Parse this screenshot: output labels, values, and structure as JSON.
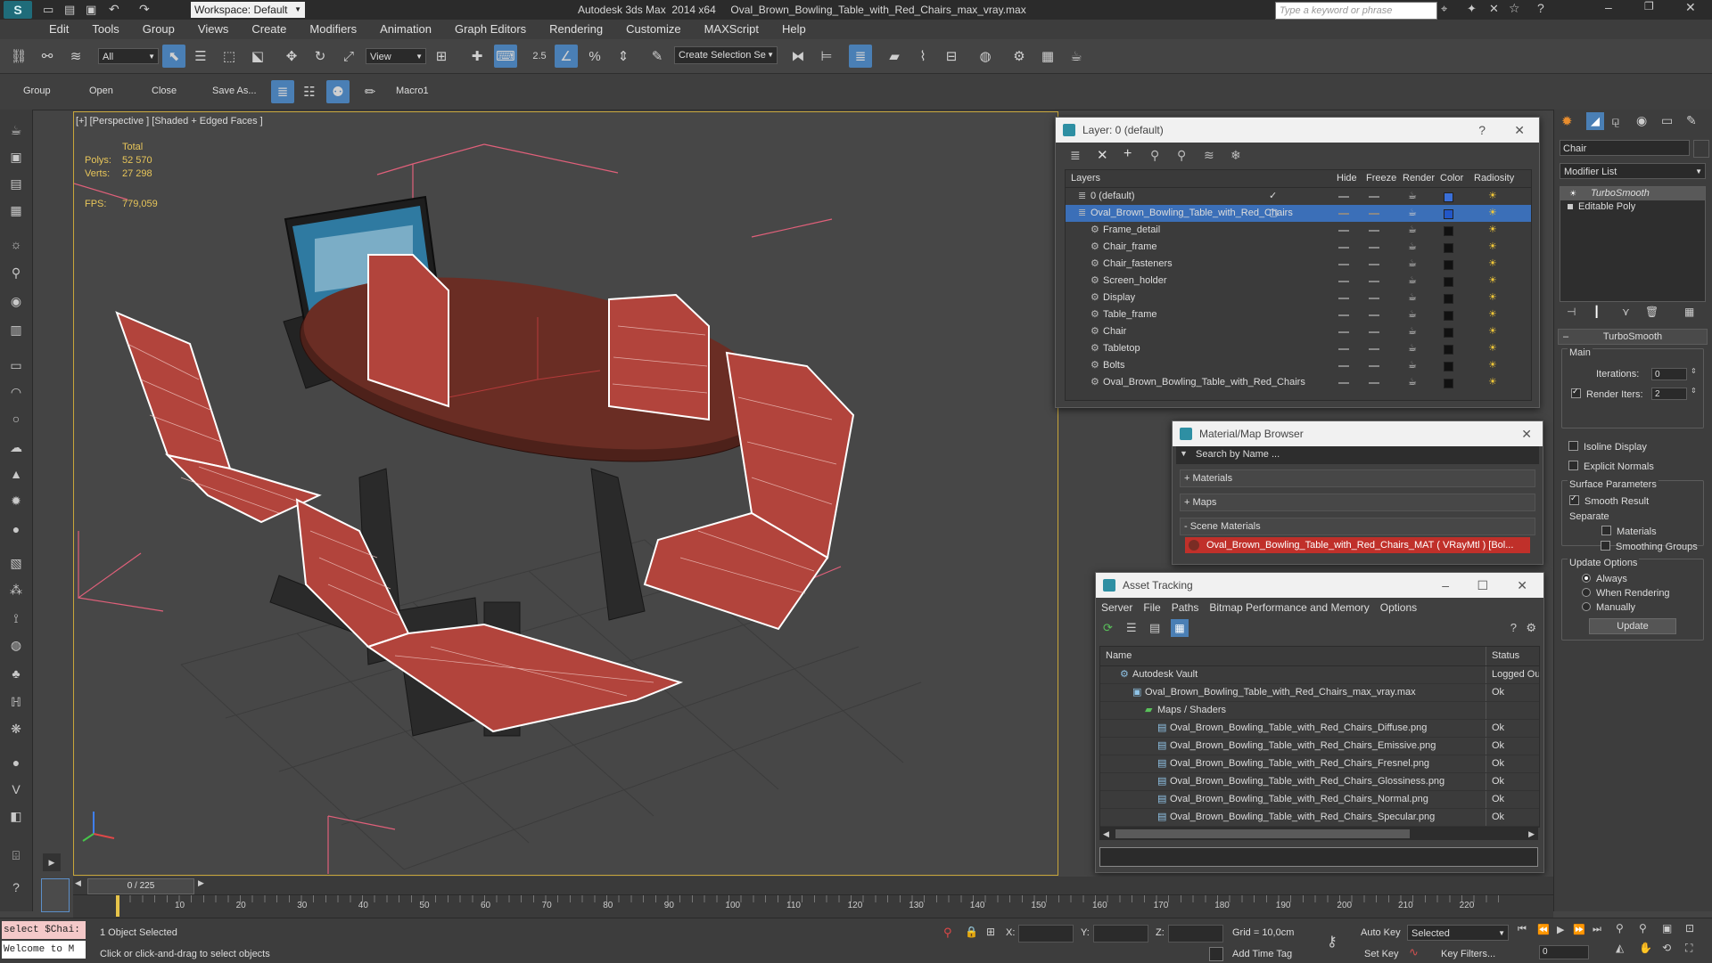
{
  "app": {
    "title": "Autodesk 3ds Max  2014 x64     Oval_Brown_Bowling_Table_with_Red_Chairs_max_vray.max",
    "workspace": "Workspace: Default",
    "search_placeholder": "Type a keyword or phrase"
  },
  "menu": [
    "Edit",
    "Tools",
    "Group",
    "Views",
    "Create",
    "Modifiers",
    "Animation",
    "Graph Editors",
    "Rendering",
    "Customize",
    "MAXScript",
    "Help"
  ],
  "toolbar": {
    "filter_dd": "All",
    "view_dd": "View",
    "selset_dd": "Create Selection Se",
    "snap_label": "2.5"
  },
  "ribbon": {
    "items": [
      "Group",
      "Open",
      "Close",
      "Save As...",
      "Macro1"
    ]
  },
  "viewport": {
    "label": "[+] [Perspective ] [Shaded + Edged Faces ]",
    "stats": {
      "total_label": "Total",
      "polys_label": "Polys:",
      "polys_value": "52 570",
      "verts_label": "Verts:",
      "verts_value": "27 298",
      "fps_label": "FPS:",
      "fps_value": "779,059"
    }
  },
  "layer_window": {
    "title": "Layer: 0 (default)",
    "columns": [
      "Layers",
      "Hide",
      "Freeze",
      "Render",
      "Color",
      "Radiosity"
    ],
    "rows": [
      {
        "name": "0 (default)",
        "indent": 0,
        "selected": false,
        "color": "#3a6fd8",
        "check": "✓"
      },
      {
        "name": "Oval_Brown_Bowling_Table_with_Red_Chairs",
        "indent": 0,
        "selected": true,
        "color": "#2257c8",
        "check": "▢"
      },
      {
        "name": "Frame_detail",
        "indent": 1,
        "selected": false,
        "color": "#111111",
        "check": ""
      },
      {
        "name": "Chair_frame",
        "indent": 1,
        "selected": false,
        "color": "#111111",
        "check": ""
      },
      {
        "name": "Chair_fasteners",
        "indent": 1,
        "selected": false,
        "color": "#111111",
        "check": ""
      },
      {
        "name": "Screen_holder",
        "indent": 1,
        "selected": false,
        "color": "#111111",
        "check": ""
      },
      {
        "name": "Display",
        "indent": 1,
        "selected": false,
        "color": "#111111",
        "check": ""
      },
      {
        "name": "Table_frame",
        "indent": 1,
        "selected": false,
        "color": "#111111",
        "check": ""
      },
      {
        "name": "Chair",
        "indent": 1,
        "selected": false,
        "color": "#111111",
        "check": ""
      },
      {
        "name": "Tabletop",
        "indent": 1,
        "selected": false,
        "color": "#111111",
        "check": ""
      },
      {
        "name": "Bolts",
        "indent": 1,
        "selected": false,
        "color": "#111111",
        "check": ""
      },
      {
        "name": "Oval_Brown_Bowling_Table_with_Red_Chairs",
        "indent": 1,
        "selected": false,
        "color": "#111111",
        "check": ""
      }
    ]
  },
  "material_browser": {
    "title": "Material/Map Browser",
    "search_placeholder": "Search by Name ...",
    "sections": [
      "+ Materials",
      "+ Maps",
      "- Scene Materials"
    ],
    "scene_material": "Oval_Brown_Bowling_Table_with_Red_Chairs_MAT ( VRayMtl ) [Bol..."
  },
  "asset_tracking": {
    "title": "Asset Tracking",
    "menu": [
      "Server",
      "File",
      "Paths",
      "Bitmap Performance and Memory",
      "Options"
    ],
    "columns": [
      "Name",
      "Status"
    ],
    "rows": [
      {
        "name": "Autodesk Vault",
        "indent": 0,
        "status": "Logged Ou"
      },
      {
        "name": "Oval_Brown_Bowling_Table_with_Red_Chairs_max_vray.max",
        "indent": 1,
        "status": "Ok"
      },
      {
        "name": "Maps / Shaders",
        "indent": 2,
        "status": ""
      },
      {
        "name": "Oval_Brown_Bowling_Table_with_Red_Chairs_Diffuse.png",
        "indent": 3,
        "status": "Ok"
      },
      {
        "name": "Oval_Brown_Bowling_Table_with_Red_Chairs_Emissive.png",
        "indent": 3,
        "status": "Ok"
      },
      {
        "name": "Oval_Brown_Bowling_Table_with_Red_Chairs_Fresnel.png",
        "indent": 3,
        "status": "Ok"
      },
      {
        "name": "Oval_Brown_Bowling_Table_with_Red_Chairs_Glossiness.png",
        "indent": 3,
        "status": "Ok"
      },
      {
        "name": "Oval_Brown_Bowling_Table_with_Red_Chairs_Normal.png",
        "indent": 3,
        "status": "Ok"
      },
      {
        "name": "Oval_Brown_Bowling_Table_with_Red_Chairs_Specular.png",
        "indent": 3,
        "status": "Ok"
      }
    ]
  },
  "command_panel": {
    "object_name": "Chair",
    "modifier_list": "Modifier List",
    "stack": [
      "TurboSmooth",
      "Editable Poly"
    ],
    "rollout_title": "TurboSmooth",
    "main_label": "Main",
    "iterations_label": "Iterations:",
    "iterations_value": "0",
    "render_iters_label": "Render Iters:",
    "render_iters_value": "2",
    "isoline_label": "Isoline Display",
    "explicit_label": "Explicit Normals",
    "surface_label": "Surface Parameters",
    "smooth_label": "Smooth Result",
    "separate_label": "Separate",
    "materials_label": "Materials",
    "smoothing_groups_label": "Smoothing Groups",
    "update_options_label": "Update Options",
    "always_label": "Always",
    "when_rendering_label": "When Rendering",
    "manually_label": "Manually",
    "update_button": "Update"
  },
  "timeline": {
    "frame_counter": "0 / 225",
    "ticks": [
      "10",
      "20",
      "30",
      "40",
      "50",
      "60",
      "70",
      "80",
      "90",
      "100",
      "110",
      "120",
      "130",
      "140",
      "150",
      "160",
      "170",
      "180",
      "190",
      "200",
      "210",
      "220"
    ]
  },
  "status": {
    "maxscript_line1": "select $Chai:",
    "maxscript_line2": "Welcome to M",
    "selected_text": "1 Object Selected",
    "prompt_text": "Click or click-and-drag to select objects",
    "x_label": "X:",
    "y_label": "Y:",
    "z_label": "Z:",
    "grid_text": "Grid = 10,0cm",
    "add_time_tag": "Add Time Tag",
    "auto_key": "Auto Key",
    "set_key": "Set Key",
    "selected_dd": "Selected",
    "key_filters": "Key Filters...",
    "frame_value": "0"
  },
  "colors": {
    "accent": "#4a7fb5",
    "chair_red": "#b2443c",
    "table_brown": "#5e2b23",
    "viewport_border": "#c8a63a"
  }
}
